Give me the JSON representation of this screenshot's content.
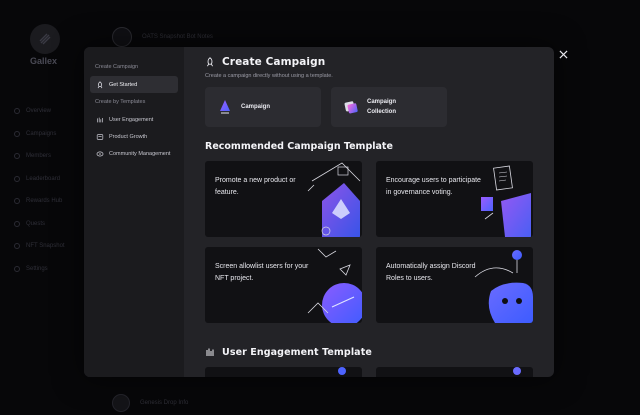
{
  "background": {
    "brand": "Gallex",
    "top_row_text": "OATS Snapshot Bot Notes",
    "bottom_row_text": "Genesis Drop Info",
    "nav": [
      "Overview",
      "Campaigns",
      "Members",
      "Leaderboard",
      "Rewards Hub",
      "Quests",
      "NFT Snapshot",
      "Settings"
    ]
  },
  "sidebar": {
    "section1": "Create Campaign",
    "get_started": "Get Started",
    "section2": "Create by Templates",
    "items": [
      {
        "label": "User Engagement",
        "icon": "user-engagement-icon"
      },
      {
        "label": "Product Growth",
        "icon": "product-growth-icon"
      },
      {
        "label": "Community Management",
        "icon": "community-icon"
      }
    ]
  },
  "main": {
    "title": "Create Campaign",
    "subtitle": "Create a campaign directly without using a template.",
    "types": [
      {
        "label": "Campaign",
        "icon": "campaign-icon"
      },
      {
        "label": "Campaign Collection",
        "icon": "collection-icon"
      }
    ],
    "recommended_title": "Recommended Campaign Template",
    "templates": [
      {
        "text": "Promote a new product or feature."
      },
      {
        "text": "Encourage users to participate in governance voting."
      },
      {
        "text": "Screen allowlist users for your NFT project."
      },
      {
        "text": "Automatically assign Discord Roles to users."
      }
    ],
    "engagement_title": "User Engagement Template"
  },
  "colors": {
    "accent_blue": "#4d63ff",
    "accent_purple": "#9b5cff",
    "modal_bg": "#232327",
    "sidebar_bg": "#1b1b1e"
  }
}
